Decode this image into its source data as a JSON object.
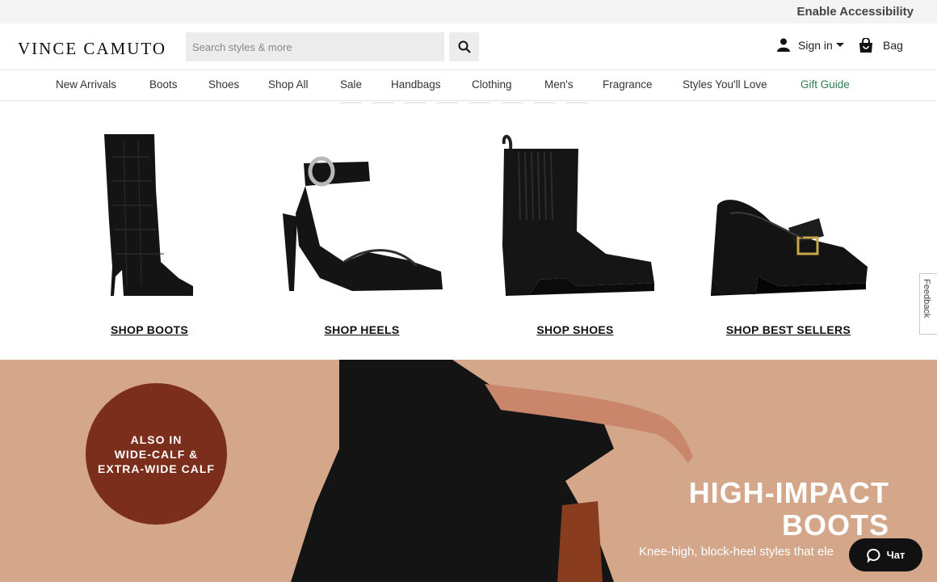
{
  "topbar": {
    "accessibility_label": "Enable Accessibility"
  },
  "header": {
    "logo": "VINCE CAMUTO",
    "search_placeholder": "Search styles & more",
    "sign_in_label": "Sign in",
    "bag_label": "Bag"
  },
  "nav": {
    "items": [
      "New Arrivals",
      "Boots",
      "Shoes",
      "Shop All",
      "Sale",
      "Handbags",
      "Clothing",
      "Men's",
      "Fragrance",
      "Styles You'll Love",
      "Gift Guide"
    ]
  },
  "products": [
    {
      "label": "SHOP BOOTS"
    },
    {
      "label": "SHOP HEELS"
    },
    {
      "label": "SHOP SHOES"
    },
    {
      "label": "SHOP BEST SELLERS"
    }
  ],
  "hero": {
    "circle_lines": [
      "ALSO IN",
      "WIDE-CALF &",
      "EXTRA-WIDE CALF"
    ],
    "title_lines": [
      "HIGH-IMPACT",
      "BOOTS"
    ],
    "subtitle": "Knee-high, block-heel styles that ele"
  },
  "chat": {
    "label": "Чат"
  },
  "feedback": {
    "label": "Feedback"
  },
  "colors": {
    "hero_bg": "#d4a68a",
    "circle_bg": "#7a2e1b",
    "gift_guide": "#2e7d4f"
  }
}
